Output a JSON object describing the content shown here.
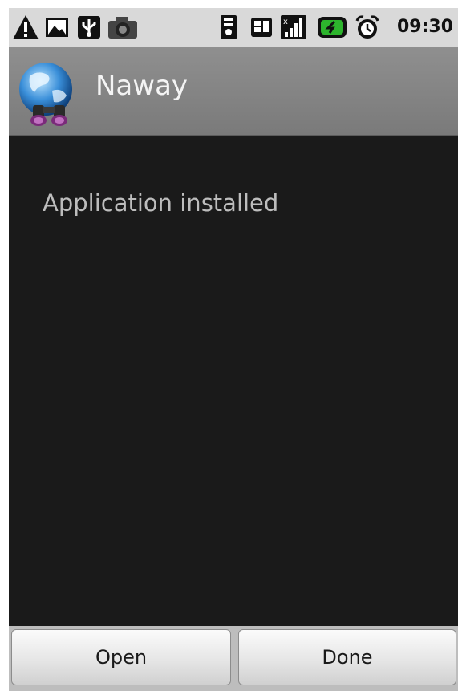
{
  "status_bar": {
    "time": "09:30",
    "icons": [
      "warning-icon",
      "gallery-icon",
      "usb-icon",
      "camera-icon",
      "wifi-icon",
      "sd-card-icon",
      "signal-icon",
      "battery-icon",
      "alarm-icon"
    ]
  },
  "title_bar": {
    "app_name": "Naway",
    "icon": "naway-globe-binoculars-icon"
  },
  "content": {
    "message": "Application installed"
  },
  "buttons": {
    "open_label": "Open",
    "done_label": "Done"
  },
  "colors": {
    "status_bar": "#d9d9d9",
    "title_bar": "#848484",
    "background": "#1a1a1a",
    "button_bar": "#bdbdbd",
    "battery_green": "#2db52d"
  }
}
